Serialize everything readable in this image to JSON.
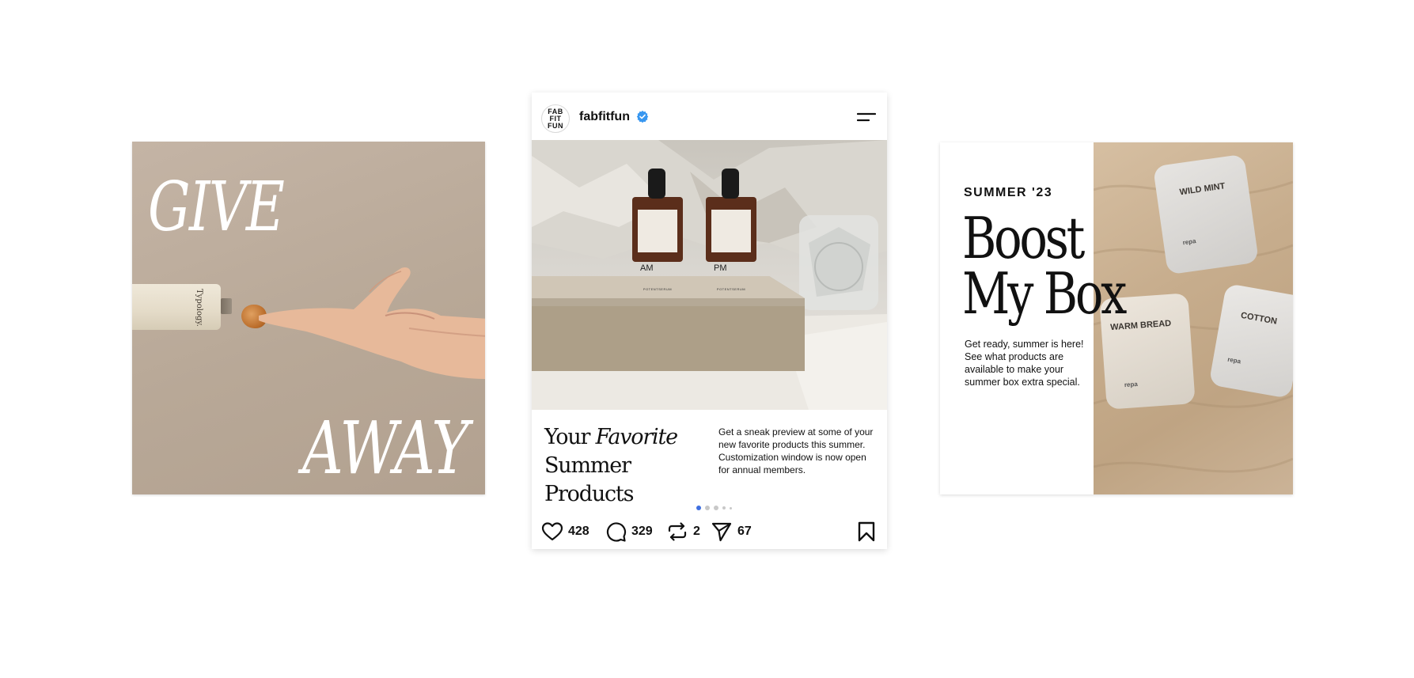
{
  "left_card": {
    "headline_top": "GIVE",
    "headline_bottom": "AWAY",
    "product_brand": "Typology."
  },
  "instagram_post": {
    "avatar_lines": [
      "FAB",
      "FIT",
      "FUN"
    ],
    "username": "fabfitfun",
    "verified": true,
    "product_labels": {
      "bottle_left": "AM",
      "bottle_right": "PM",
      "bottle_brand": "POTENTSERUM"
    },
    "caption_title_line1_plain": "Your ",
    "caption_title_line1_italic": "Favorite",
    "caption_title_line2": "Summer Products",
    "caption_body": "Get a sneak preview at some of your new favorite products this summer. Customization window is now open for annual members.",
    "carousel": {
      "total": 5,
      "active_index": 0
    },
    "stats": {
      "likes": "428",
      "comments": "329",
      "reposts": "2",
      "shares": "67"
    },
    "accent_color": "#3f6fe0"
  },
  "right_card": {
    "eyebrow": "SUMMER '23",
    "headline_line1": "Boost",
    "headline_line2": "My Box",
    "body": "Get ready, summer is here! See what products are available to make your summer box extra special.",
    "candles": [
      {
        "name": "WILD MINT",
        "brand": "repa"
      },
      {
        "name": "WARM BREAD",
        "brand": "repa"
      },
      {
        "name": "COTTON",
        "brand": "repa"
      }
    ]
  }
}
